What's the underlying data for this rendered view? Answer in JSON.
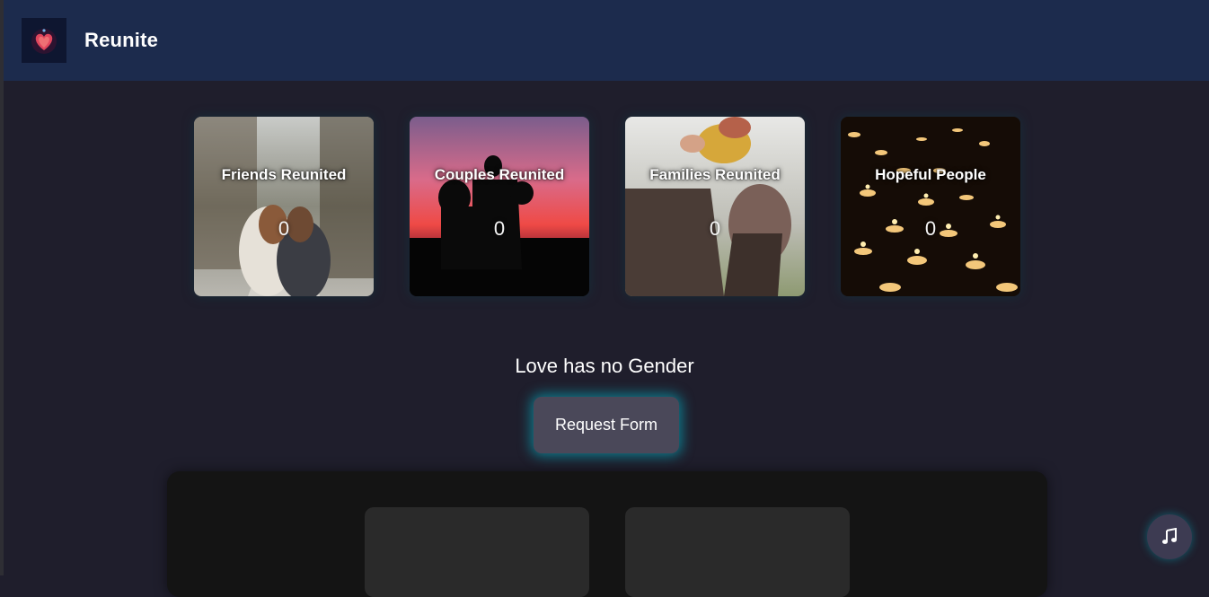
{
  "header": {
    "brand": "Reunite",
    "logo_icon": "heart-logo-icon"
  },
  "stats": [
    {
      "title": "Friends Reunited",
      "count": "0",
      "image": "friends-hugging-photo"
    },
    {
      "title": "Couples Reunited",
      "count": "0",
      "image": "couple-silhouette-sunset-photo"
    },
    {
      "title": "Families Reunited",
      "count": "0",
      "image": "parent-lifting-child-photo"
    },
    {
      "title": "Hopeful People",
      "count": "0",
      "image": "candles-photo"
    }
  ],
  "tagline": "Love has no Gender",
  "request_button": {
    "label": "Request Form"
  },
  "music_button": {
    "icon": "music-note-icon"
  },
  "colors": {
    "header_bg": "#1c2b4d",
    "page_bg": "#1f1e2c",
    "button_bg": "#4a4859",
    "glow": "#00c8dc"
  }
}
